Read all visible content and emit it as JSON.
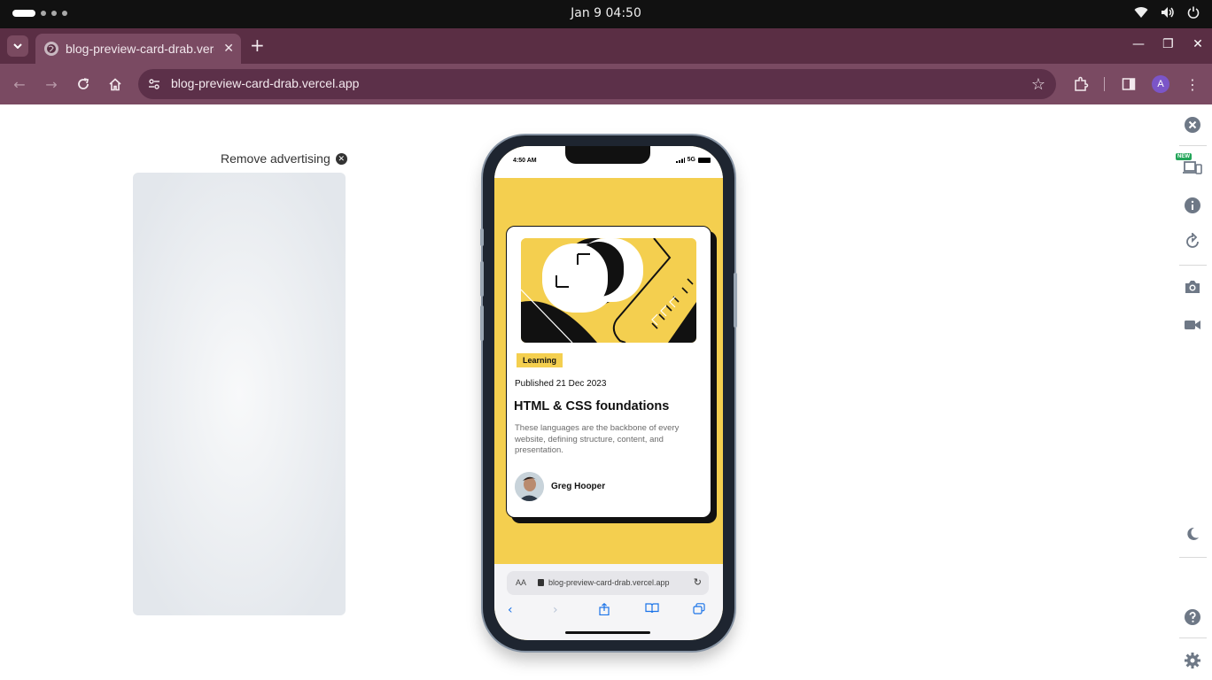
{
  "os": {
    "clock": "Jan 9  04:50"
  },
  "browser": {
    "tab_title": "blog-preview-card-drab.vercel.app",
    "url": "blog-preview-card-drab.vercel.app",
    "profile_initial": "A"
  },
  "page": {
    "remove_ad_label": "Remove advertising"
  },
  "phone": {
    "status_time": "4:50 AM",
    "network": "5G",
    "card": {
      "tag": "Learning",
      "published": "Published 21 Dec 2023",
      "title": "HTML & CSS foundations",
      "description": "These languages are the backbone of every website, defining structure, content, and presentation.",
      "author": "Greg Hooper"
    },
    "safari": {
      "aa": "AA",
      "url": "blog-preview-card-drab.vercel.app"
    }
  },
  "side_panel": {
    "new_badge": "NEW"
  },
  "colors": {
    "accent_yellow": "#f4cf4f",
    "browser_frame": "#7a4a62",
    "tab_strip": "#5a2e44"
  }
}
